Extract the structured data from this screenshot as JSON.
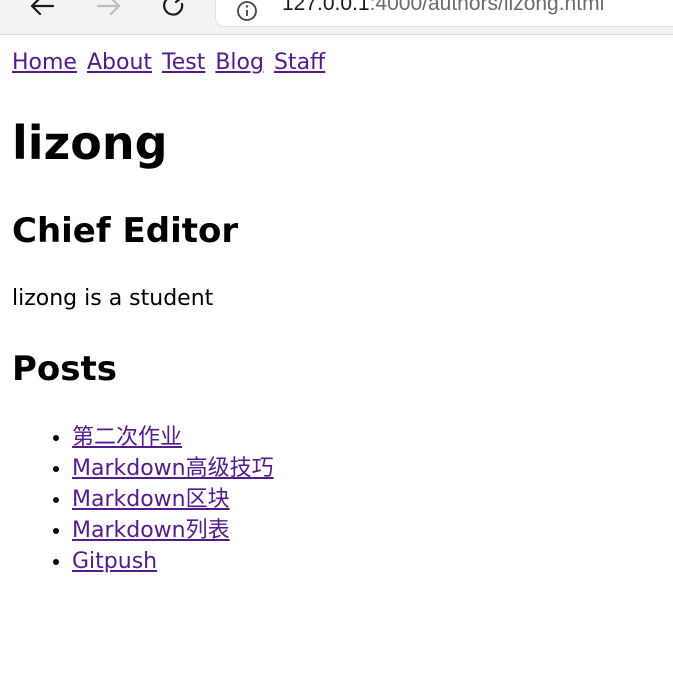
{
  "browser": {
    "url_host": "127.0.0.1",
    "url_rest": ":4000/authors/lizong.html"
  },
  "nav": {
    "links": [
      "Home",
      "About",
      "Test",
      "Blog",
      "Staff"
    ]
  },
  "author": {
    "name": "lizong",
    "role": "Chief Editor",
    "bio": "lizong is a student"
  },
  "posts": {
    "heading": "Posts",
    "items": [
      "第二次作业",
      "Markdown高级技巧",
      "Markdown区块",
      "Markdown列表",
      "Gitpush"
    ]
  },
  "colors": {
    "link_visited": "#551a8b",
    "text": "#000000",
    "chrome_bg": "#f3f3f3"
  }
}
